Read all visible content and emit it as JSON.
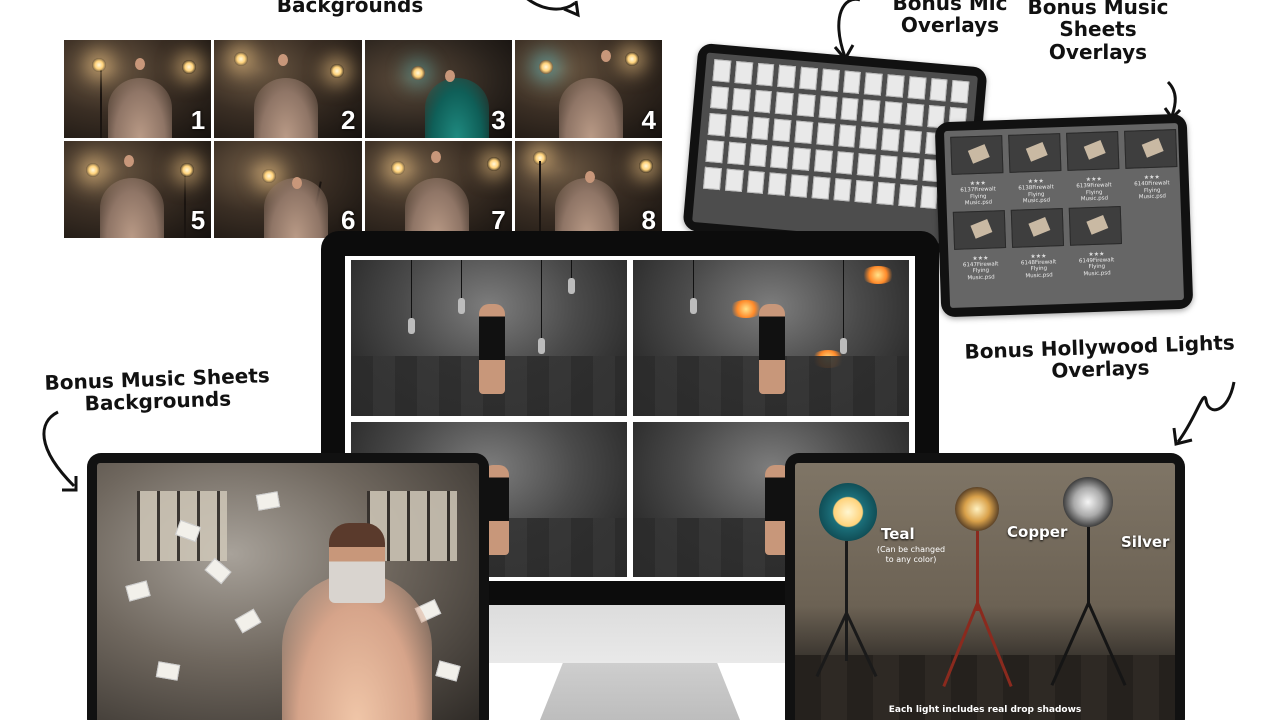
{
  "callouts": {
    "backgrounds": "Backgrounds",
    "mic": "Bonus Mic\nOverlays",
    "music_sheets_overlays": "Bonus Music\nSheets\nOverlays",
    "hollywood": "Bonus Hollywood Lights\nOverlays",
    "music_sheets_backgrounds": "Bonus Music Sheets\nBackgrounds"
  },
  "thumbnails": [
    "1",
    "2",
    "3",
    "4",
    "5",
    "6",
    "7",
    "8"
  ],
  "psd_files": [
    {
      "stars": "★★★",
      "name": "6137Firewalt Flying\nMusic.psd"
    },
    {
      "stars": "★★★",
      "name": "6138Firewalt Flying\nMusic.psd"
    },
    {
      "stars": "★★★",
      "name": "6139Firewalt Flying\nMusic.psd"
    },
    {
      "stars": "★★★",
      "name": "6140Firewalt Flying\nMusic.psd"
    },
    {
      "stars": "★★★",
      "name": "6147Firewalt Flying\nMusic.psd"
    },
    {
      "stars": "★★★",
      "name": "6148Firewalt Flying\nMusic.psd"
    },
    {
      "stars": "★★★",
      "name": "6149Firewalt Flying\nMusic.psd"
    }
  ],
  "lights_demo": {
    "teal": "Teal",
    "teal_sub": "(Can be changed\nto any color)",
    "copper": "Copper",
    "silver": "Silver",
    "caption": "Each light includes real drop shadows"
  }
}
